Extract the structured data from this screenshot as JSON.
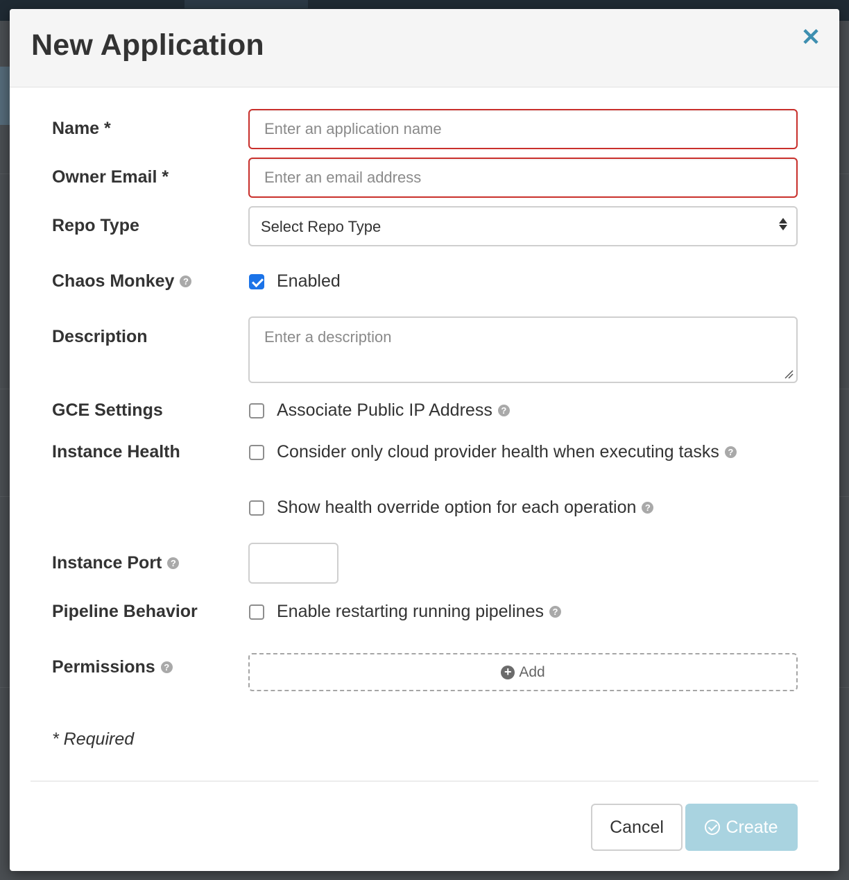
{
  "modal": {
    "title": "New Application",
    "close_symbol": "✕"
  },
  "form": {
    "name": {
      "label": "Name *",
      "placeholder": "Enter an application name",
      "value": ""
    },
    "owner_email": {
      "label": "Owner Email *",
      "placeholder": "Enter an email address",
      "value": ""
    },
    "repo_type": {
      "label": "Repo Type",
      "selected": "Select Repo Type"
    },
    "chaos_monkey": {
      "label": "Chaos Monkey",
      "option_label": "Enabled",
      "checked": true
    },
    "description": {
      "label": "Description",
      "placeholder": "Enter a description",
      "value": ""
    },
    "gce_settings": {
      "label": "GCE Settings",
      "option_label": "Associate Public IP Address",
      "checked": false
    },
    "instance_health": {
      "label": "Instance Health",
      "options": [
        {
          "label": "Consider only cloud provider health when executing tasks",
          "checked": false
        },
        {
          "label": "Show health override option for each operation",
          "checked": false
        }
      ]
    },
    "instance_port": {
      "label": "Instance Port",
      "value": ""
    },
    "pipeline_behavior": {
      "label": "Pipeline Behavior",
      "option_label": "Enable restarting running pipelines",
      "checked": false
    },
    "permissions": {
      "label": "Permissions",
      "add_label": "Add"
    },
    "required_note": "* Required"
  },
  "footer": {
    "cancel_label": "Cancel",
    "create_label": "Create"
  },
  "colors": {
    "accent": "#3e8fb0",
    "error_border": "#c9302c",
    "checkbox_checked": "#1b73e8",
    "create_disabled": "#a9d3e0"
  },
  "icons": {
    "help": "question-circle-icon",
    "close": "close-icon",
    "add": "plus-circle-icon",
    "create": "check-circle-icon"
  }
}
